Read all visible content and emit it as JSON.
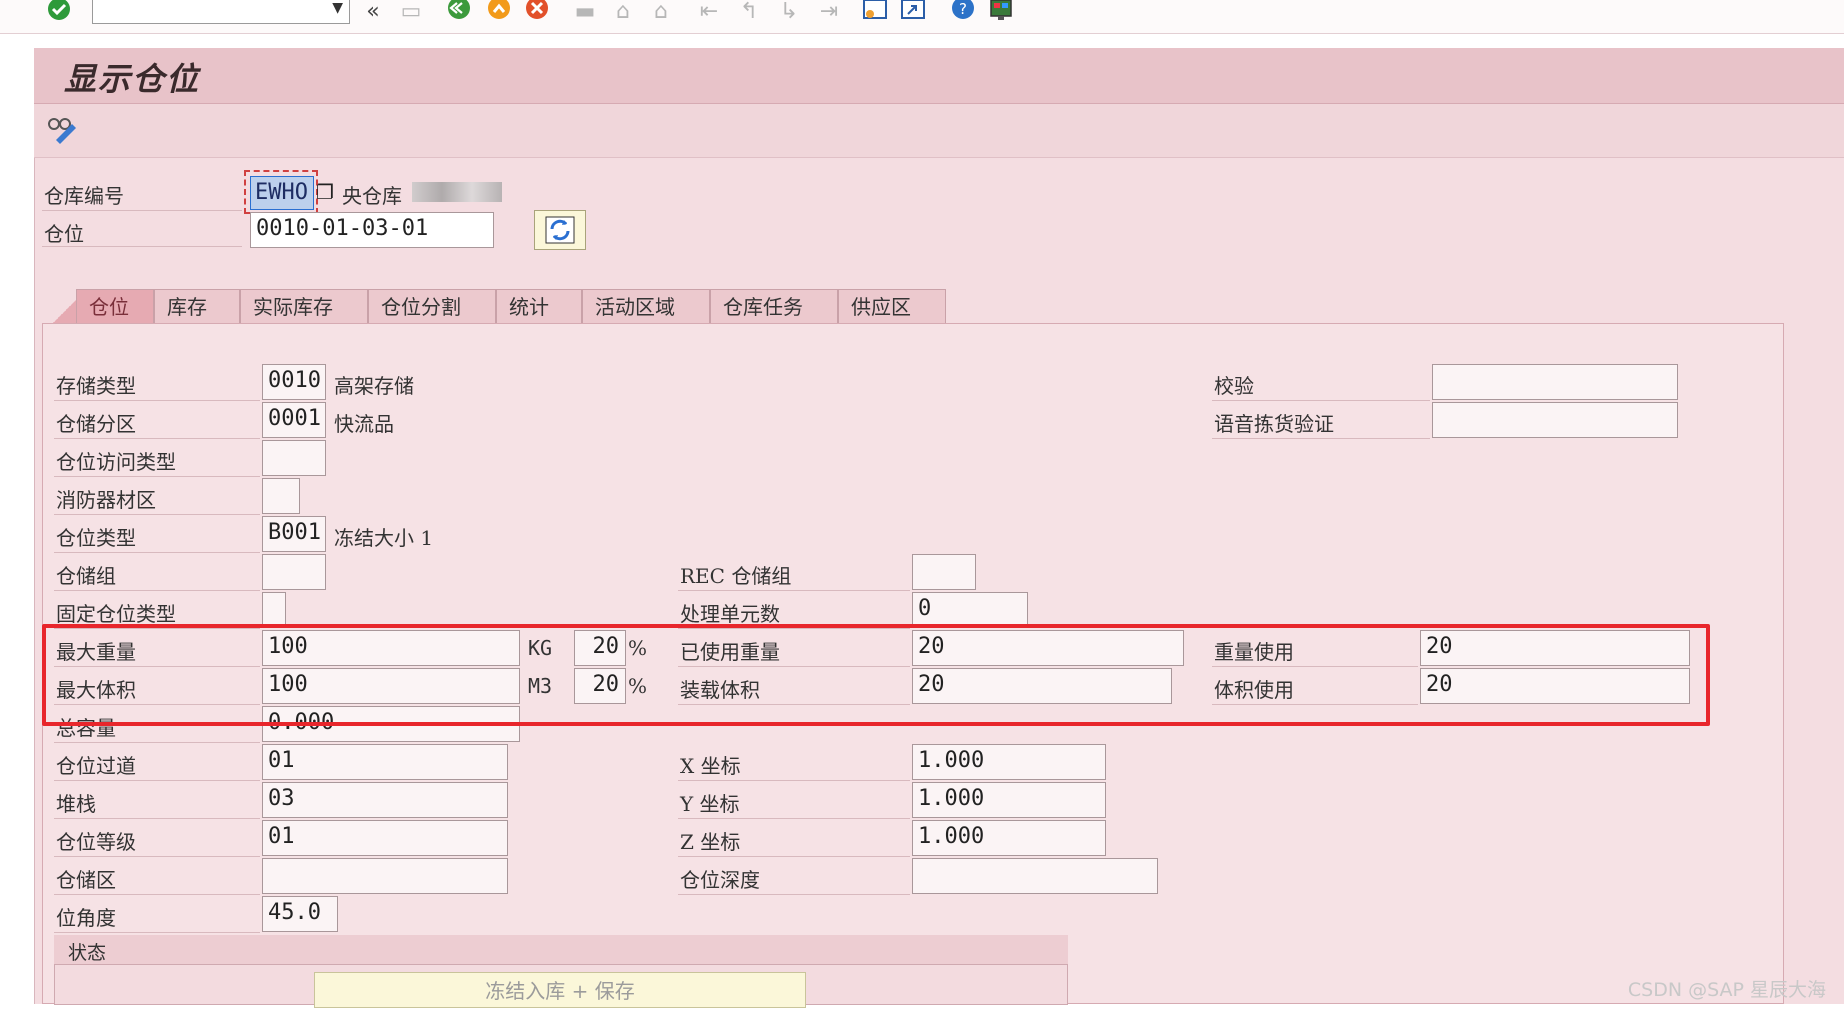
{
  "toolbar": {
    "icons": [
      "enter-icon",
      "command-field",
      "back-icon",
      "save-icon",
      "back-green-icon",
      "exit-icon",
      "cancel-icon",
      "print-icon",
      "find-icon",
      "find-next-icon",
      "first-page-icon",
      "prev-page-icon",
      "next-page-icon",
      "last-page-icon",
      "new-session-icon",
      "shortcut-icon",
      "help-icon",
      "customize-icon"
    ],
    "command_value": ""
  },
  "page": {
    "title": "显示仓位"
  },
  "header": {
    "warehouse_label": "仓库编号",
    "warehouse_value": "EWHO",
    "warehouse_desc": "央仓库",
    "bin_label": "仓位",
    "bin_value": "0010-01-03-01"
  },
  "tabs": [
    {
      "label": "仓位"
    },
    {
      "label": "库存"
    },
    {
      "label": "实际库存"
    },
    {
      "label": "仓位分割"
    },
    {
      "label": "统计"
    },
    {
      "label": "活动区域"
    },
    {
      "label": "仓库任务"
    },
    {
      "label": "供应区"
    }
  ],
  "fields": {
    "storage_type": {
      "label": "存储类型",
      "value": "0010",
      "desc": "高架存储"
    },
    "storage_section": {
      "label": "仓储分区",
      "value": "0001",
      "desc": "快流品"
    },
    "bin_access_type": {
      "label": "仓位访问类型",
      "value": ""
    },
    "fire_area": {
      "label": "消防器材区",
      "value": ""
    },
    "bin_type": {
      "label": "仓位类型",
      "value": "B001",
      "desc": "冻结大小 1"
    },
    "storage_group": {
      "label": "仓储组",
      "value": ""
    },
    "fixed_bin_type": {
      "label": "固定仓位类型",
      "value": ""
    },
    "max_weight": {
      "label": "最大重量",
      "value": "100",
      "unit": "KG",
      "pct": "20",
      "pct_sign": "%"
    },
    "max_volume": {
      "label": "最大体积",
      "value": "100",
      "unit": "M3",
      "pct": "20",
      "pct_sign": "%"
    },
    "total_capacity": {
      "label": "总容量",
      "value": "0.000"
    },
    "bin_aisle": {
      "label": "仓位过道",
      "value": "01"
    },
    "stack": {
      "label": "堆栈",
      "value": "03"
    },
    "bin_level": {
      "label": "仓位等级",
      "value": "01"
    },
    "storage_area": {
      "label": "仓储区",
      "value": ""
    },
    "angle": {
      "label": "位角度",
      "value": "45.0"
    },
    "rec_group": {
      "label": "REC 仓储组",
      "value": ""
    },
    "handling_units": {
      "label": "处理单元数",
      "value": "0"
    },
    "used_weight": {
      "label": "已使用重量",
      "value": "20"
    },
    "loaded_volume": {
      "label": "装载体积",
      "value": "20"
    },
    "x_coord": {
      "label": "X 坐标",
      "value": "1.000"
    },
    "y_coord": {
      "label": "Y 坐标",
      "value": "1.000"
    },
    "z_coord": {
      "label": "Z 坐标",
      "value": "1.000"
    },
    "bin_depth": {
      "label": "仓位深度",
      "value": ""
    },
    "check": {
      "label": "校验",
      "value": ""
    },
    "voice_pick": {
      "label": "语音拣货验证",
      "value": ""
    },
    "weight_usage": {
      "label": "重量使用",
      "value": "20"
    },
    "volume_usage": {
      "label": "体积使用",
      "value": "20"
    }
  },
  "status": {
    "header": "状态",
    "button": "冻结入库 + 保存"
  },
  "watermark": "CSDN @SAP 星辰大海"
}
